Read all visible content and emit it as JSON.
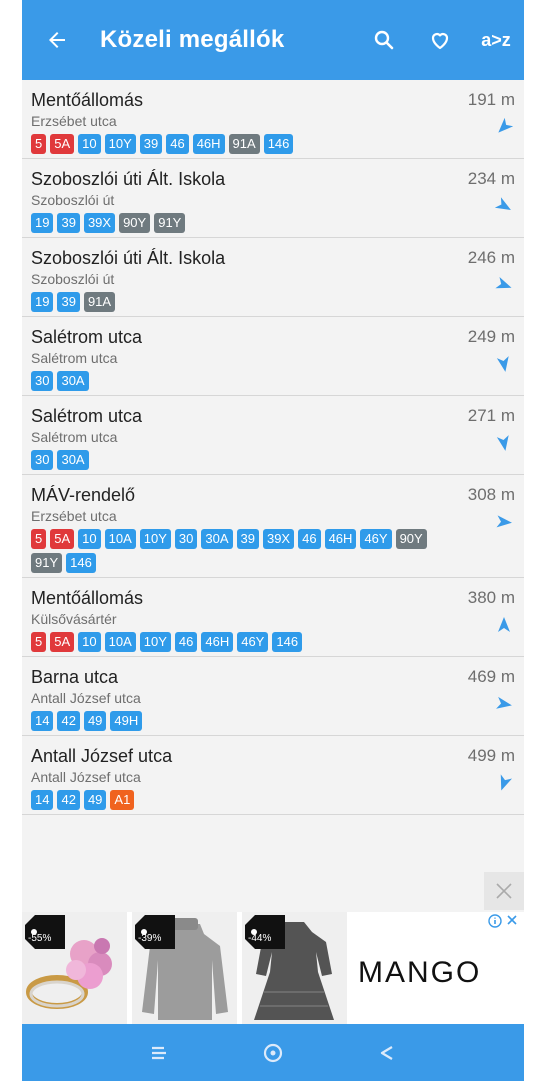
{
  "app": {
    "title": "Közeli megállók",
    "sort_label": "a>z"
  },
  "colors": {
    "primary": "#3a9ae8",
    "red": "#e0393b",
    "blue": "#2f9bea",
    "gray": "#6f7a7f",
    "orange": "#f0631f"
  },
  "stops": [
    {
      "name": "Mentőállomás",
      "street": "Erzsébet utca",
      "distance": "191 m",
      "bearing": 225,
      "routes": [
        {
          "n": "5",
          "c": "red"
        },
        {
          "n": "5A",
          "c": "red"
        },
        {
          "n": "10",
          "c": "blue"
        },
        {
          "n": "10Y",
          "c": "blue"
        },
        {
          "n": "39",
          "c": "blue"
        },
        {
          "n": "46",
          "c": "blue"
        },
        {
          "n": "46H",
          "c": "blue"
        },
        {
          "n": "91A",
          "c": "gray"
        },
        {
          "n": "146",
          "c": "blue"
        }
      ]
    },
    {
      "name": "Szoboszlói úti Ált. Iskola",
      "street": "Szoboszlói út",
      "distance": "234 m",
      "bearing": 120,
      "routes": [
        {
          "n": "19",
          "c": "blue"
        },
        {
          "n": "39",
          "c": "blue"
        },
        {
          "n": "39X",
          "c": "blue"
        },
        {
          "n": "90Y",
          "c": "gray"
        },
        {
          "n": "91Y",
          "c": "gray"
        }
      ]
    },
    {
      "name": "Szoboszlói úti Ált. Iskola",
      "street": "Szoboszlói út",
      "distance": "246 m",
      "bearing": 110,
      "routes": [
        {
          "n": "19",
          "c": "blue"
        },
        {
          "n": "39",
          "c": "blue"
        },
        {
          "n": "91A",
          "c": "gray"
        }
      ]
    },
    {
      "name": "Salétrom utca",
      "street": "Salétrom utca",
      "distance": "249 m",
      "bearing": 170,
      "routes": [
        {
          "n": "30",
          "c": "blue"
        },
        {
          "n": "30A",
          "c": "blue"
        }
      ]
    },
    {
      "name": "Salétrom utca",
      "street": "Salétrom utca",
      "distance": "271 m",
      "bearing": 170,
      "routes": [
        {
          "n": "30",
          "c": "blue"
        },
        {
          "n": "30A",
          "c": "blue"
        }
      ]
    },
    {
      "name": "MÁV-rendelő",
      "street": "Erzsébet utca",
      "distance": "308 m",
      "bearing": 95,
      "routes": [
        {
          "n": "5",
          "c": "red"
        },
        {
          "n": "5A",
          "c": "red"
        },
        {
          "n": "10",
          "c": "blue"
        },
        {
          "n": "10A",
          "c": "blue"
        },
        {
          "n": "10Y",
          "c": "blue"
        },
        {
          "n": "30",
          "c": "blue"
        },
        {
          "n": "30A",
          "c": "blue"
        },
        {
          "n": "39",
          "c": "blue"
        },
        {
          "n": "39X",
          "c": "blue"
        },
        {
          "n": "46",
          "c": "blue"
        },
        {
          "n": "46H",
          "c": "blue"
        },
        {
          "n": "46Y",
          "c": "blue"
        },
        {
          "n": "90Y",
          "c": "gray"
        },
        {
          "n": "91Y",
          "c": "gray"
        },
        {
          "n": "146",
          "c": "blue"
        }
      ]
    },
    {
      "name": "Mentőállomás",
      "street": "Külsővásártér",
      "distance": "380 m",
      "bearing": 0,
      "routes": [
        {
          "n": "5",
          "c": "red"
        },
        {
          "n": "5A",
          "c": "red"
        },
        {
          "n": "10",
          "c": "blue"
        },
        {
          "n": "10A",
          "c": "blue"
        },
        {
          "n": "10Y",
          "c": "blue"
        },
        {
          "n": "46",
          "c": "blue"
        },
        {
          "n": "46H",
          "c": "blue"
        },
        {
          "n": "46Y",
          "c": "blue"
        },
        {
          "n": "146",
          "c": "blue"
        }
      ]
    },
    {
      "name": "Barna utca",
      "street": "Antall József utca",
      "distance": "469 m",
      "bearing": 100,
      "routes": [
        {
          "n": "14",
          "c": "blue"
        },
        {
          "n": "42",
          "c": "blue"
        },
        {
          "n": "49",
          "c": "blue"
        },
        {
          "n": "49H",
          "c": "blue"
        }
      ]
    },
    {
      "name": "Antall József utca",
      "street": "Antall József utca",
      "distance": "499 m",
      "bearing": 200,
      "routes": [
        {
          "n": "14",
          "c": "blue"
        },
        {
          "n": "42",
          "c": "blue"
        },
        {
          "n": "49",
          "c": "blue"
        },
        {
          "n": "A1",
          "c": "orange"
        }
      ]
    }
  ],
  "ad": {
    "brand": "MANGO",
    "info_icon": "info-icon",
    "tiles": [
      {
        "discount": "-55%"
      },
      {
        "discount": "-39%"
      },
      {
        "discount": "-44%"
      }
    ]
  }
}
